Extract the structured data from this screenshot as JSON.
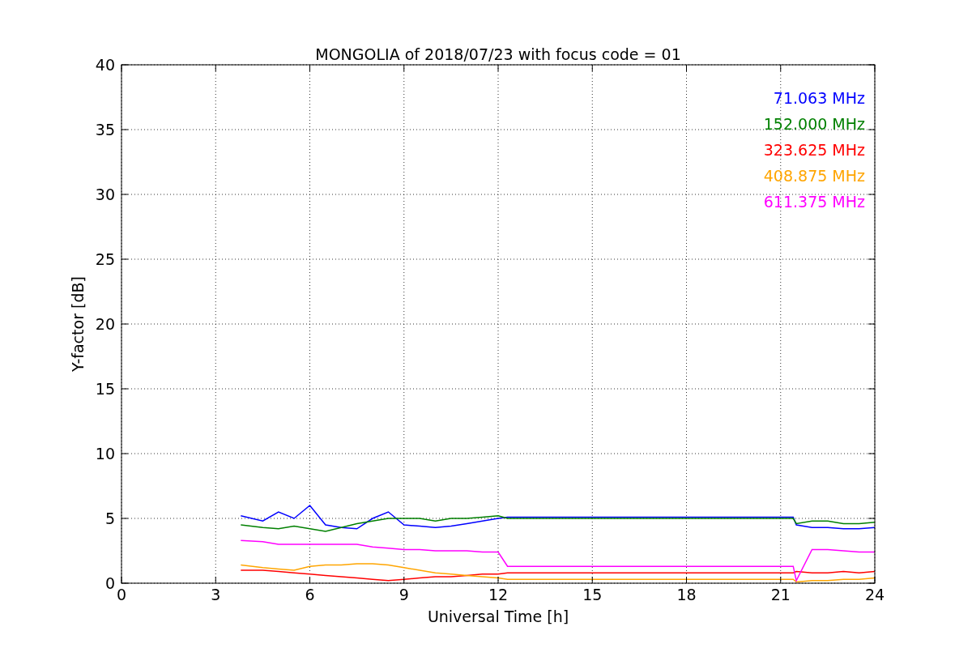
{
  "figure": {
    "chart_data": {
      "type": "line",
      "title": "MONGOLIA of 2018/07/23 with focus code = 01",
      "xlabel": "Universal Time [h]",
      "ylabel": "Y-factor [dB]",
      "grid": true,
      "x": [
        3.8,
        4.5,
        5,
        5.5,
        6,
        6.5,
        7,
        7.5,
        8,
        8.5,
        9,
        9.5,
        10,
        10.5,
        11,
        11.5,
        12,
        12.3,
        15,
        18,
        21.4,
        21.5,
        22,
        22.5,
        23,
        23.5,
        24
      ],
      "series": [
        {
          "name": "71.063 MHz",
          "color": "#0000ff",
          "values": [
            5.2,
            4.8,
            5.5,
            5.0,
            6.0,
            4.5,
            4.3,
            4.2,
            5.0,
            5.5,
            4.5,
            4.4,
            4.3,
            4.4,
            4.6,
            4.8,
            5.0,
            5.1,
            5.1,
            5.1,
            5.1,
            4.5,
            4.3,
            4.3,
            4.2,
            4.2,
            4.3
          ]
        },
        {
          "name": "152.000 MHz",
          "color": "#008000",
          "values": [
            4.5,
            4.3,
            4.2,
            4.4,
            4.2,
            4.0,
            4.3,
            4.6,
            4.8,
            5.0,
            5.0,
            5.0,
            4.8,
            5.0,
            5.0,
            5.1,
            5.2,
            5.0,
            5.0,
            5.0,
            5.0,
            4.6,
            4.8,
            4.8,
            4.6,
            4.6,
            4.7
          ]
        },
        {
          "name": "323.625 MHz",
          "color": "#ff0000",
          "values": [
            1.0,
            1.0,
            0.9,
            0.8,
            0.7,
            0.6,
            0.5,
            0.4,
            0.3,
            0.2,
            0.3,
            0.4,
            0.5,
            0.5,
            0.6,
            0.7,
            0.7,
            0.8,
            0.8,
            0.8,
            0.8,
            0.9,
            0.8,
            0.8,
            0.9,
            0.8,
            0.9
          ]
        },
        {
          "name": "408.875 MHz",
          "color": "#ffa500",
          "values": [
            1.4,
            1.2,
            1.1,
            1.0,
            1.3,
            1.4,
            1.4,
            1.5,
            1.5,
            1.4,
            1.2,
            1.0,
            0.8,
            0.7,
            0.6,
            0.5,
            0.4,
            0.3,
            0.3,
            0.3,
            0.3,
            0.1,
            0.2,
            0.2,
            0.3,
            0.3,
            0.4
          ]
        },
        {
          "name": "611.375 MHz",
          "color": "#ff00ff",
          "values": [
            3.3,
            3.2,
            3.0,
            3.0,
            3.0,
            3.0,
            3.0,
            3.0,
            2.8,
            2.7,
            2.6,
            2.6,
            2.5,
            2.5,
            2.5,
            2.4,
            2.4,
            1.3,
            1.3,
            1.3,
            1.3,
            0.2,
            2.6,
            2.6,
            2.5,
            2.4,
            2.4
          ]
        }
      ],
      "xlim": [
        0,
        24
      ],
      "ylim": [
        0,
        40
      ],
      "xticks": [
        0,
        3,
        6,
        9,
        12,
        15,
        18,
        21,
        24
      ],
      "yticks": [
        0,
        5,
        10,
        15,
        20,
        25,
        30,
        35,
        40
      ]
    }
  }
}
